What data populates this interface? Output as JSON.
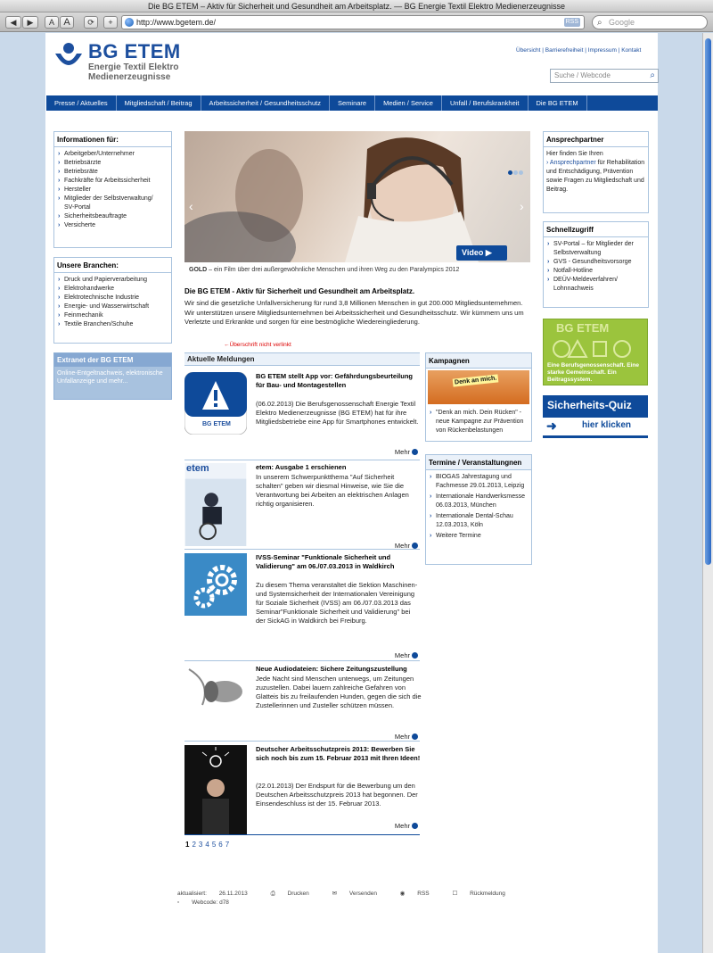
{
  "window": {
    "title": "Die BG ETEM – Aktiv für Sicherheit und Gesundheit am Arbeitsplatz. — BG Energie Textil Elektro Medienerzeugnisse"
  },
  "browser": {
    "url": "http://www.bgetem.de/",
    "rss": "RSS",
    "search_placeholder": "Google",
    "back": "◀",
    "forward": "▶",
    "text_small": "A",
    "text_large": "A",
    "add": "+"
  },
  "header": {
    "logo_title": "BG ETEM",
    "logo_sub1": "Energie Textil Elektro",
    "logo_sub2": "Medienerzeugnisse",
    "top_links": [
      "Übersicht",
      "Barrierefreiheit",
      "Impressum",
      "Kontakt"
    ],
    "search_placeholder": "Suche / Webcode"
  },
  "nav": [
    "Presse / Aktuelles",
    "Mitgliedschaft / Beitrag",
    "Arbeitssicherheit / Gesundheitsschutz",
    "Seminare",
    "Medien / Service",
    "Unfall / Berufskrankheit",
    "Die BG ETEM"
  ],
  "left": {
    "info_title": "Informationen für:",
    "info_items": [
      "Arbeitgeber/Unternehmer",
      "Betriebsärzte",
      "Betriebsräte",
      "Fachkräfte für Arbeitssicherheit",
      "Hersteller",
      "Mitglieder der Selbstverwaltung/",
      "SV-Portal",
      "Sicherheitsbeauftragte",
      "Versicherte"
    ],
    "branch_title": "Unsere Branchen:",
    "branch_items": [
      "Druck und Papierverarbeitung",
      "Elektrohandwerke",
      "Elektrotechnische Industrie",
      "Energie- und Wasserwirtschaft",
      "Feinmechanik",
      "Textile Branchen/Schuhe"
    ],
    "extranet_title": "Extranet der BG ETEM",
    "extranet_text": "Online-Entgeltnachweis, elektronische Unfallanzeige und mehr..."
  },
  "hero": {
    "caption_bold": "GOLD",
    "caption_rest": " – ein Film über drei außergewöhnliche Menschen und ihren Weg zu den Paralympics 2012",
    "video_label": "Video",
    "prev": "‹",
    "next": "›"
  },
  "intro": {
    "title": "Die BG ETEM - Aktiv für Sicherheit und Gesundheit am Arbeitsplatz.",
    "text": "Wir sind die gesetzliche Unfallversicherung für rund 3,8 Millionen Menschen in gut 200.000 Mitgliedsunternehmen. Wir unterstützen unsere Mitgliedsunternehmen bei Arbeitssicherheit und Gesundheitsschutz. Wir kümmern uns um Verletzte und Erkrankte und sorgen für eine bestmögliche Wiedereingliederung."
  },
  "annotation": "Überschrift nicht verlinkt",
  "news": {
    "title": "Aktuelle Meldungen",
    "more": "Mehr",
    "items": [
      {
        "title": "BG ETEM stellt App vor: Gefährdungsbeurteilung für Bau- und Montagestellen",
        "text": "(06.02.2013) Die Berufsgenossenschaft Energie Textil Elektro Medienerzeugnisse (BG ETEM) hat für ihre Mitgliedsbetriebe eine App für Smartphones entwickelt.",
        "thumb_label": "BG ETEM"
      },
      {
        "title": "etem: Ausgabe 1 erschienen",
        "text": "In unserem Schwerpunktthema \"Auf Sicherheit schalten\" geben wir diesmal Hinweise, wie Sie die Verantwortung bei Arbeiten an elektrischen Anlagen richtig organisieren.",
        "thumb_label": "etem"
      },
      {
        "title": "IVSS-Seminar \"Funktionale Sicherheit und Validierung\" am 06./07.03.2013 in Waldkirch",
        "text": "Zu diesem Thema veranstaltet die Sektion Maschinen- und Systemsicherheit der Internationalen Vereinigung für Soziale Sicherheit (IVSS) am 06./07.03.2013 das Seminar\"Funktionale Sicherheit und Validierung\" bei der SickAG in Waldkirch bei Freiburg."
      },
      {
        "title": "Neue Audiodateien: Sichere Zeitungszustellung",
        "text": "Jede Nacht sind Menschen unterwegs, um Zeitungen zuzustellen. Dabei lauern zahlreiche Gefahren von Glatteis bis zu freilaufenden Hunden, gegen die sich die Zustellerinnen und Zusteller schützen müssen."
      },
      {
        "title": "Deutscher Arbeitsschutzpreis 2013: Bewerben Sie sich noch bis zum 15. Februar 2013 mit Ihren Ideen!",
        "text": "(22.01.2013) Der Endspurt für die Bewerbung um den Deutschen Arbeitsschutzpreis 2013 hat begonnen. Der Einsendeschluss ist der 15. Februar 2013."
      }
    ],
    "pages": [
      "1",
      "2",
      "3",
      "4",
      "5",
      "6",
      "7"
    ]
  },
  "kampagnen": {
    "title": "Kampagnen",
    "item": "\"Denk an mich. Dein Rücken\" - neue Kampagne zur Prävention von Rückenbelastungen",
    "banner": "Denk an mich."
  },
  "termine": {
    "title": "Termine / Veranstaltungnen",
    "items": [
      "BIOGAS Jahrestagung und Fachmesse 29.01.2013, Leipzig",
      "Internationale Handwerksmesse 06.03.2013, München",
      "Internationale Dental-Schau 12.03.2013, Köln",
      "Weitere Termine"
    ]
  },
  "right": {
    "contact_title": "Ansprechpartner",
    "contact_text1": "Hier finden Sie Ihren",
    "contact_link": "Ansprechpartner",
    "contact_text2": " für Rehabilitation und Entschädigung, Prävention sowie Fragen zu Mitgliedschaft und Beitrag.",
    "quick_title": "Schnellzugriff",
    "quick_items": [
      "SV-Portal – für Mitglieder der Selbstverwaltung",
      "GVS - Gesundheitsvorsorge",
      "Notfall-Hotline",
      "DEÜV-Meldeverfahren/ Lohnnachweis"
    ],
    "ad1_title": "BG ETEM",
    "ad1_sub": "Eine Berufsgenossenschaft. Eine starke Gemeinschaft. Ein Beitragssystem.",
    "ad2_title": "Sicherheits-Quiz",
    "ad2_link": "hier klicken"
  },
  "footer": {
    "updated_label": "aktualisiert:",
    "updated": "26.11.2013",
    "print": "Drucken",
    "send": "Versenden",
    "rss": "RSS",
    "feedback": "Rückmeldung",
    "webcode": "Webcode: d78"
  }
}
